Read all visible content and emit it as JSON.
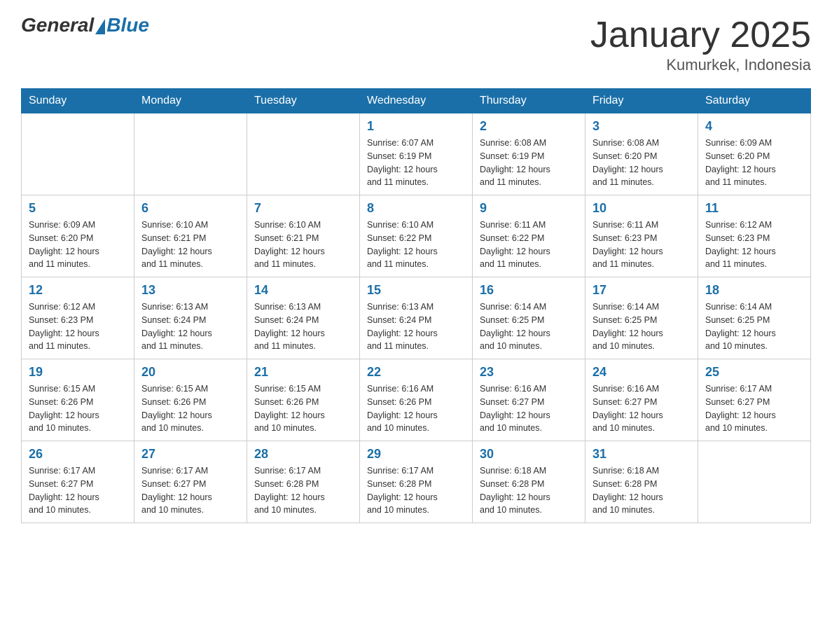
{
  "header": {
    "logo": {
      "general_text": "General",
      "blue_text": "Blue"
    },
    "title": "January 2025",
    "location": "Kumurkek, Indonesia"
  },
  "days_of_week": [
    "Sunday",
    "Monday",
    "Tuesday",
    "Wednesday",
    "Thursday",
    "Friday",
    "Saturday"
  ],
  "weeks": [
    {
      "days": [
        {
          "number": "",
          "info": ""
        },
        {
          "number": "",
          "info": ""
        },
        {
          "number": "",
          "info": ""
        },
        {
          "number": "1",
          "info": "Sunrise: 6:07 AM\nSunset: 6:19 PM\nDaylight: 12 hours\nand 11 minutes."
        },
        {
          "number": "2",
          "info": "Sunrise: 6:08 AM\nSunset: 6:19 PM\nDaylight: 12 hours\nand 11 minutes."
        },
        {
          "number": "3",
          "info": "Sunrise: 6:08 AM\nSunset: 6:20 PM\nDaylight: 12 hours\nand 11 minutes."
        },
        {
          "number": "4",
          "info": "Sunrise: 6:09 AM\nSunset: 6:20 PM\nDaylight: 12 hours\nand 11 minutes."
        }
      ]
    },
    {
      "days": [
        {
          "number": "5",
          "info": "Sunrise: 6:09 AM\nSunset: 6:20 PM\nDaylight: 12 hours\nand 11 minutes."
        },
        {
          "number": "6",
          "info": "Sunrise: 6:10 AM\nSunset: 6:21 PM\nDaylight: 12 hours\nand 11 minutes."
        },
        {
          "number": "7",
          "info": "Sunrise: 6:10 AM\nSunset: 6:21 PM\nDaylight: 12 hours\nand 11 minutes."
        },
        {
          "number": "8",
          "info": "Sunrise: 6:10 AM\nSunset: 6:22 PM\nDaylight: 12 hours\nand 11 minutes."
        },
        {
          "number": "9",
          "info": "Sunrise: 6:11 AM\nSunset: 6:22 PM\nDaylight: 12 hours\nand 11 minutes."
        },
        {
          "number": "10",
          "info": "Sunrise: 6:11 AM\nSunset: 6:23 PM\nDaylight: 12 hours\nand 11 minutes."
        },
        {
          "number": "11",
          "info": "Sunrise: 6:12 AM\nSunset: 6:23 PM\nDaylight: 12 hours\nand 11 minutes."
        }
      ]
    },
    {
      "days": [
        {
          "number": "12",
          "info": "Sunrise: 6:12 AM\nSunset: 6:23 PM\nDaylight: 12 hours\nand 11 minutes."
        },
        {
          "number": "13",
          "info": "Sunrise: 6:13 AM\nSunset: 6:24 PM\nDaylight: 12 hours\nand 11 minutes."
        },
        {
          "number": "14",
          "info": "Sunrise: 6:13 AM\nSunset: 6:24 PM\nDaylight: 12 hours\nand 11 minutes."
        },
        {
          "number": "15",
          "info": "Sunrise: 6:13 AM\nSunset: 6:24 PM\nDaylight: 12 hours\nand 11 minutes."
        },
        {
          "number": "16",
          "info": "Sunrise: 6:14 AM\nSunset: 6:25 PM\nDaylight: 12 hours\nand 10 minutes."
        },
        {
          "number": "17",
          "info": "Sunrise: 6:14 AM\nSunset: 6:25 PM\nDaylight: 12 hours\nand 10 minutes."
        },
        {
          "number": "18",
          "info": "Sunrise: 6:14 AM\nSunset: 6:25 PM\nDaylight: 12 hours\nand 10 minutes."
        }
      ]
    },
    {
      "days": [
        {
          "number": "19",
          "info": "Sunrise: 6:15 AM\nSunset: 6:26 PM\nDaylight: 12 hours\nand 10 minutes."
        },
        {
          "number": "20",
          "info": "Sunrise: 6:15 AM\nSunset: 6:26 PM\nDaylight: 12 hours\nand 10 minutes."
        },
        {
          "number": "21",
          "info": "Sunrise: 6:15 AM\nSunset: 6:26 PM\nDaylight: 12 hours\nand 10 minutes."
        },
        {
          "number": "22",
          "info": "Sunrise: 6:16 AM\nSunset: 6:26 PM\nDaylight: 12 hours\nand 10 minutes."
        },
        {
          "number": "23",
          "info": "Sunrise: 6:16 AM\nSunset: 6:27 PM\nDaylight: 12 hours\nand 10 minutes."
        },
        {
          "number": "24",
          "info": "Sunrise: 6:16 AM\nSunset: 6:27 PM\nDaylight: 12 hours\nand 10 minutes."
        },
        {
          "number": "25",
          "info": "Sunrise: 6:17 AM\nSunset: 6:27 PM\nDaylight: 12 hours\nand 10 minutes."
        }
      ]
    },
    {
      "days": [
        {
          "number": "26",
          "info": "Sunrise: 6:17 AM\nSunset: 6:27 PM\nDaylight: 12 hours\nand 10 minutes."
        },
        {
          "number": "27",
          "info": "Sunrise: 6:17 AM\nSunset: 6:27 PM\nDaylight: 12 hours\nand 10 minutes."
        },
        {
          "number": "28",
          "info": "Sunrise: 6:17 AM\nSunset: 6:28 PM\nDaylight: 12 hours\nand 10 minutes."
        },
        {
          "number": "29",
          "info": "Sunrise: 6:17 AM\nSunset: 6:28 PM\nDaylight: 12 hours\nand 10 minutes."
        },
        {
          "number": "30",
          "info": "Sunrise: 6:18 AM\nSunset: 6:28 PM\nDaylight: 12 hours\nand 10 minutes."
        },
        {
          "number": "31",
          "info": "Sunrise: 6:18 AM\nSunset: 6:28 PM\nDaylight: 12 hours\nand 10 minutes."
        },
        {
          "number": "",
          "info": ""
        }
      ]
    }
  ],
  "colors": {
    "header_bg": "#1a6fa8",
    "header_text": "#ffffff",
    "day_number": "#1a6fa8",
    "border": "#cccccc",
    "text": "#333333"
  }
}
